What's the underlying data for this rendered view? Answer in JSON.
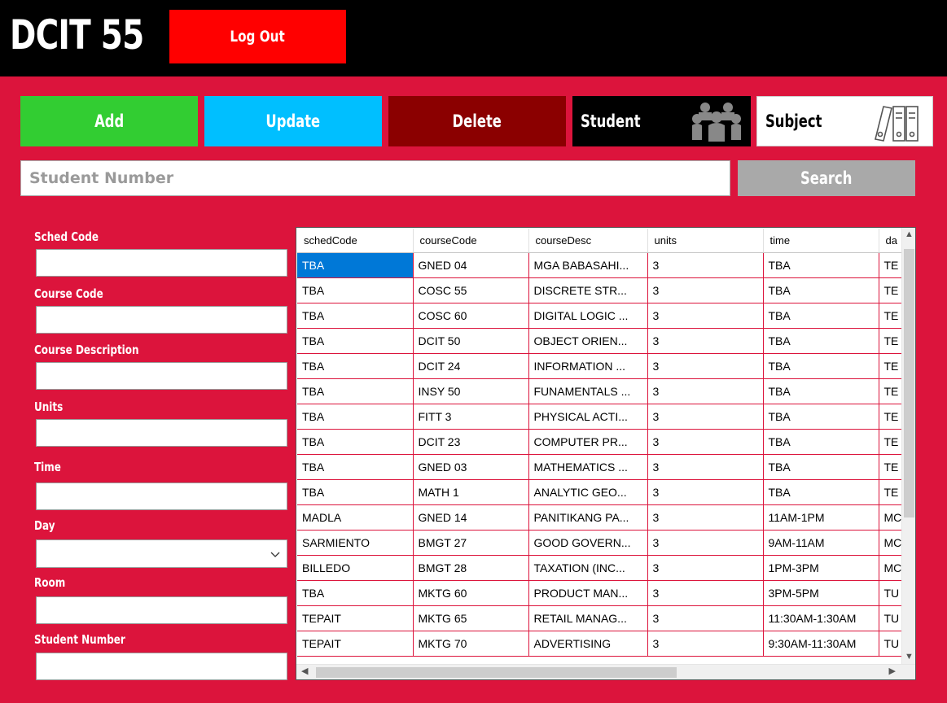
{
  "header": {
    "title": "DCIT 55",
    "logout_label": "Log Out"
  },
  "actions": {
    "add": "Add",
    "update": "Update",
    "delete": "Delete",
    "student": "Student",
    "subject": "Subject"
  },
  "search": {
    "placeholder": "Student Number",
    "button": "Search"
  },
  "form": {
    "sched_code": "Sched Code",
    "course_code": "Course Code",
    "course_description": "Course Description",
    "units": "Units",
    "time": "Time",
    "day": "Day",
    "room": "Room",
    "student_number": "Student Number"
  },
  "grid": {
    "columns": [
      "schedCode",
      "courseCode",
      "courseDesc",
      "units",
      "time",
      "da"
    ],
    "rows": [
      [
        "TBA",
        "GNED 04",
        "MGA BABASAHI...",
        "3",
        "TBA",
        "TE"
      ],
      [
        "TBA",
        "COSC 55",
        "DISCRETE STR...",
        "3",
        "TBA",
        "TE"
      ],
      [
        "TBA",
        "COSC 60",
        "DIGITAL LOGIC ...",
        "3",
        "TBA",
        "TE"
      ],
      [
        "TBA",
        "DCIT 50",
        "OBJECT ORIEN...",
        "3",
        "TBA",
        "TE"
      ],
      [
        "TBA",
        "DCIT 24",
        "INFORMATION ...",
        "3",
        "TBA",
        "TE"
      ],
      [
        "TBA",
        "INSY 50",
        "FUNAMENTALS ...",
        "3",
        "TBA",
        "TE"
      ],
      [
        "TBA",
        "FITT 3",
        "PHYSICAL ACTI...",
        "3",
        "TBA",
        "TE"
      ],
      [
        "TBA",
        "DCIT 23",
        "COMPUTER PR...",
        "3",
        "TBA",
        "TE"
      ],
      [
        "TBA",
        "GNED 03",
        "MATHEMATICS ...",
        "3",
        "TBA",
        "TE"
      ],
      [
        "TBA",
        "MATH 1",
        "ANALYTIC GEO...",
        "3",
        "TBA",
        "TE"
      ],
      [
        "MADLA",
        "GNED 14",
        "PANITIKANG PA...",
        "3",
        "11AM-1PM",
        "MC"
      ],
      [
        "SARMIENTO",
        "BMGT 27",
        "GOOD GOVERN...",
        "3",
        "9AM-11AM",
        "MC"
      ],
      [
        "BILLEDO",
        "BMGT 28",
        "TAXATION (INC...",
        "3",
        "1PM-3PM",
        "MC"
      ],
      [
        "TBA",
        "MKTG 60",
        "PRODUCT MAN...",
        "3",
        "3PM-5PM",
        "TU"
      ],
      [
        "TEPAIT",
        "MKTG 65",
        "RETAIL MANAG...",
        "3",
        "11:30AM-1:30AM",
        "TU"
      ],
      [
        "TEPAIT",
        "MKTG 70",
        "ADVERTISING",
        "3",
        "9:30AM-11:30AM",
        "TU"
      ]
    ]
  },
  "colors": {
    "background": "#dc143c",
    "add": "#32cd32",
    "update": "#00bfff",
    "delete": "#8b0000",
    "logout": "#ff0000",
    "search": "#a9a9a9",
    "selected": "#0078d7"
  }
}
